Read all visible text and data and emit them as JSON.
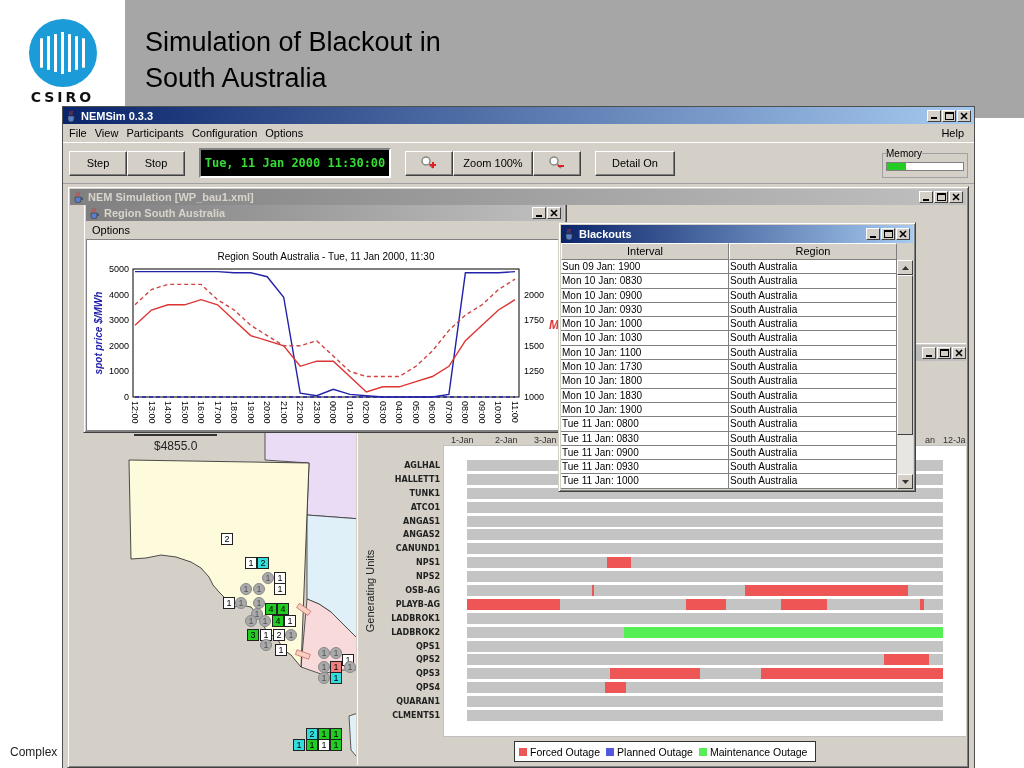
{
  "slide": {
    "logo_text": "CSIRO",
    "title_lines": [
      "Simulation of Blackout in",
      "South Australia"
    ],
    "footer": "Complex"
  },
  "app": {
    "title": "NEMSim 0.3.3",
    "active": true,
    "menu": [
      "File",
      "View",
      "Participants",
      "Configuration",
      "Options"
    ],
    "help_menu": "Help",
    "toolbar_groups": [
      [
        {
          "kind": "button",
          "label": "Step"
        },
        {
          "kind": "button",
          "label": "Stop"
        }
      ],
      [
        {
          "kind": "clock",
          "text": "Tue, 11 Jan 2000 11:30:00"
        }
      ],
      [
        {
          "kind": "zoom_in"
        },
        {
          "kind": "button",
          "label": "Zoom 100%"
        },
        {
          "kind": "zoom_out"
        }
      ],
      [
        {
          "kind": "button",
          "label": "Detail On"
        }
      ]
    ],
    "memory": {
      "label": "Memory",
      "level": 0.25
    }
  },
  "simulation_window": {
    "title": "NEM Simulation [WP_bau1.xml]",
    "active": false
  },
  "region_window": {
    "title": "Region South Australia",
    "active": false,
    "menu": [
      "Options"
    ],
    "chart_data": {
      "type": "line",
      "title": "Region South Australia - Tue, 11 Jan 2000, 11:30",
      "ylabel": "spot price $/MWh",
      "y2label": "M",
      "categories": [
        "12:00",
        "13:00",
        "14:00",
        "15:00",
        "16:00",
        "17:00",
        "18:00",
        "19:00",
        "20:00",
        "21:00",
        "22:00",
        "23:00",
        "00:00",
        "01:00",
        "02:00",
        "03:00",
        "04:00",
        "05:00",
        "06:00",
        "07:00",
        "08:00",
        "09:00",
        "10:00",
        "11:00"
      ],
      "ylim": [
        0,
        5000
      ],
      "yticks": [
        0,
        1000,
        2000,
        3000,
        4000,
        5000
      ],
      "y2lim": [
        1000,
        2250
      ],
      "y2ticks": [
        1000,
        1250,
        1500,
        1750,
        2000
      ],
      "series": [
        {
          "color": "#2222aa",
          "values": [
            4900,
            4900,
            4900,
            4900,
            4900,
            4900,
            4850,
            4850,
            4700,
            3900,
            150,
            50,
            300,
            100,
            50,
            0,
            0,
            0,
            0,
            100,
            4850,
            4850,
            4850,
            4900
          ]
        },
        {
          "color": "#2222aa",
          "line_style": "dashed",
          "values": [
            0,
            0,
            0,
            0,
            0,
            0,
            0,
            0,
            0,
            0,
            0,
            0,
            0,
            0,
            0,
            0,
            0,
            0,
            0,
            0,
            0,
            0,
            0,
            0
          ]
        },
        {
          "color": "#dd3333",
          "axis": "y2",
          "values": [
            1700,
            1850,
            1900,
            1900,
            1950,
            1900,
            1750,
            1600,
            1550,
            1500,
            1300,
            1350,
            1350,
            1200,
            1050,
            1100,
            1100,
            1150,
            1200,
            1300,
            1550,
            1700,
            1850,
            1950
          ]
        },
        {
          "color": "#cc4444",
          "axis": "y2",
          "line_style": "dashed",
          "values": [
            1900,
            2050,
            2100,
            2100,
            2100,
            1950,
            1850,
            1700,
            1600,
            1500,
            1500,
            1550,
            1400,
            1250,
            1200,
            1200,
            1200,
            1300,
            1450,
            1650,
            1800,
            1900,
            2050,
            2150
          ]
        }
      ]
    }
  },
  "map": {
    "price": "$4855.0",
    "markers": [
      {
        "label": "2",
        "kind": "box",
        "color": "#ffffff"
      },
      {
        "label": "1",
        "kind": "box",
        "color": "#ffffff"
      },
      {
        "label": "2",
        "kind": "box",
        "color": "#33dddd"
      },
      {
        "label": "1",
        "kind": "circle",
        "color": "#aaaaaa"
      },
      {
        "label": "1",
        "kind": "box",
        "color": "#ffffff"
      },
      {
        "label": "1",
        "kind": "circle",
        "color": "#aaaaaa"
      },
      {
        "label": "1",
        "kind": "circle",
        "color": "#aaaaaa"
      },
      {
        "label": "1",
        "kind": "box",
        "color": "#ffffff"
      },
      {
        "label": "1",
        "kind": "box",
        "color": "#ffffff"
      },
      {
        "label": "1",
        "kind": "circle",
        "color": "#aaaaaa"
      },
      {
        "label": "1",
        "kind": "circle",
        "color": "#aaaaaa"
      },
      {
        "label": "4",
        "kind": "box",
        "color": "#22cc22"
      },
      {
        "label": "4",
        "kind": "box",
        "color": "#22cc22"
      },
      {
        "label": "1",
        "kind": "circle",
        "color": "#aaaaaa"
      },
      {
        "label": "1",
        "kind": "circle",
        "color": "#aaaaaa"
      },
      {
        "label": "1",
        "kind": "circle",
        "color": "#aaaaaa"
      },
      {
        "label": "4",
        "kind": "box",
        "color": "#22cc22"
      },
      {
        "label": "1",
        "kind": "box",
        "color": "#ffffff"
      },
      {
        "label": "3",
        "kind": "box",
        "color": "#22cc22"
      },
      {
        "label": "1",
        "kind": "box",
        "color": "#ffffff"
      },
      {
        "label": "2",
        "kind": "box",
        "color": "#ffffff"
      },
      {
        "label": "1",
        "kind": "circle",
        "color": "#aaaaaa"
      },
      {
        "label": "1",
        "kind": "circle",
        "color": "#aaaaaa"
      },
      {
        "label": "1",
        "kind": "box",
        "color": "#ffffff"
      },
      {
        "label": "1",
        "kind": "circle",
        "color": "#aaaaaa"
      },
      {
        "label": "1",
        "kind": "circle",
        "color": "#aaaaaa"
      },
      {
        "label": "1",
        "kind": "box",
        "color": "#ffffff"
      },
      {
        "label": "1",
        "kind": "circle",
        "color": "#aaaaaa"
      },
      {
        "label": "1",
        "kind": "box",
        "color": "#f08080"
      },
      {
        "label": "1",
        "kind": "circle",
        "color": "#aaaaaa"
      },
      {
        "label": "1",
        "kind": "circle",
        "color": "#aaaaaa"
      },
      {
        "label": "1",
        "kind": "box",
        "color": "#33dddd"
      },
      {
        "label": "2",
        "kind": "box",
        "color": "#33dddd"
      },
      {
        "label": "1",
        "kind": "box",
        "color": "#22cc22"
      },
      {
        "label": "1",
        "kind": "box",
        "color": "#22cc22"
      },
      {
        "label": "1",
        "kind": "box",
        "color": "#33dddd"
      },
      {
        "label": "1",
        "kind": "box",
        "color": "#22cc22"
      },
      {
        "label": "1",
        "kind": "box",
        "color": "#ffffff"
      },
      {
        "label": "1",
        "kind": "box",
        "color": "#22cc22"
      }
    ]
  },
  "gantt_window": {
    "active": false,
    "axis_labels": [
      "1-Jan",
      "2-Jan",
      "3-Jan",
      "an",
      "12-Ja"
    ],
    "ylabel": "Generating Units",
    "rows": [
      {
        "unit": "AGLHAL",
        "outages": []
      },
      {
        "unit": "HALLETT1",
        "outages": []
      },
      {
        "unit": "TUNK1",
        "outages": []
      },
      {
        "unit": "ATCO1",
        "outages": []
      },
      {
        "unit": "ANGAS1",
        "outages": []
      },
      {
        "unit": "ANGAS2",
        "outages": []
      },
      {
        "unit": "CANUND1",
        "outages": []
      },
      {
        "unit": "NPS1",
        "outages": [
          {
            "kind": "forced"
          }
        ]
      },
      {
        "unit": "NPS2",
        "outages": []
      },
      {
        "unit": "OSB-AG",
        "outages": [
          {
            "kind": "forced"
          },
          {
            "kind": "forced"
          }
        ]
      },
      {
        "unit": "PLAYB-AG",
        "outages": [
          {
            "kind": "forced"
          },
          {
            "kind": "forced"
          },
          {
            "kind": "forced"
          },
          {
            "kind": "forced"
          }
        ]
      },
      {
        "unit": "LADBROK1",
        "outages": []
      },
      {
        "unit": "LADBROK2",
        "outages": [
          {
            "kind": "maintenance"
          }
        ]
      },
      {
        "unit": "QPS1",
        "outages": []
      },
      {
        "unit": "QPS2",
        "outages": [
          {
            "kind": "forced"
          }
        ]
      },
      {
        "unit": "QPS3",
        "outages": [
          {
            "kind": "forced"
          },
          {
            "kind": "forced"
          }
        ]
      },
      {
        "unit": "QPS4",
        "outages": [
          {
            "kind": "forced"
          }
        ]
      },
      {
        "unit": "QUARAN1",
        "outages": []
      },
      {
        "unit": "CLMENTS1",
        "outages": []
      }
    ],
    "legend": [
      {
        "kind": "forced",
        "label": "Forced Outage",
        "color": "#ee5555"
      },
      {
        "kind": "planned",
        "label": "Planned Outage",
        "color": "#5555dd"
      },
      {
        "kind": "maintenance",
        "label": "Maintenance Outage",
        "color": "#55ee55"
      }
    ]
  },
  "blackouts_window": {
    "title": "Blackouts",
    "active": true,
    "columns": [
      "Interval",
      "Region"
    ],
    "rows": [
      [
        "Sun 09 Jan: 1900",
        "South Australia"
      ],
      [
        "Mon 10 Jan: 0830",
        "South Australia"
      ],
      [
        "Mon 10 Jan: 0900",
        "South Australia"
      ],
      [
        "Mon 10 Jan: 0930",
        "South Australia"
      ],
      [
        "Mon 10 Jan: 1000",
        "South Australia"
      ],
      [
        "Mon 10 Jan: 1030",
        "South Australia"
      ],
      [
        "Mon 10 Jan: 1100",
        "South Australia"
      ],
      [
        "Mon 10 Jan: 1730",
        "South Australia"
      ],
      [
        "Mon 10 Jan: 1800",
        "South Australia"
      ],
      [
        "Mon 10 Jan: 1830",
        "South Australia"
      ],
      [
        "Mon 10 Jan: 1900",
        "South Australia"
      ],
      [
        "Tue 11 Jan: 0800",
        "South Australia"
      ],
      [
        "Tue 11 Jan: 0830",
        "South Australia"
      ],
      [
        "Tue 11 Jan: 0900",
        "South Australia"
      ],
      [
        "Tue 11 Jan: 0930",
        "South Australia"
      ],
      [
        "Tue 11 Jan: 1000",
        "South Australia"
      ]
    ]
  }
}
